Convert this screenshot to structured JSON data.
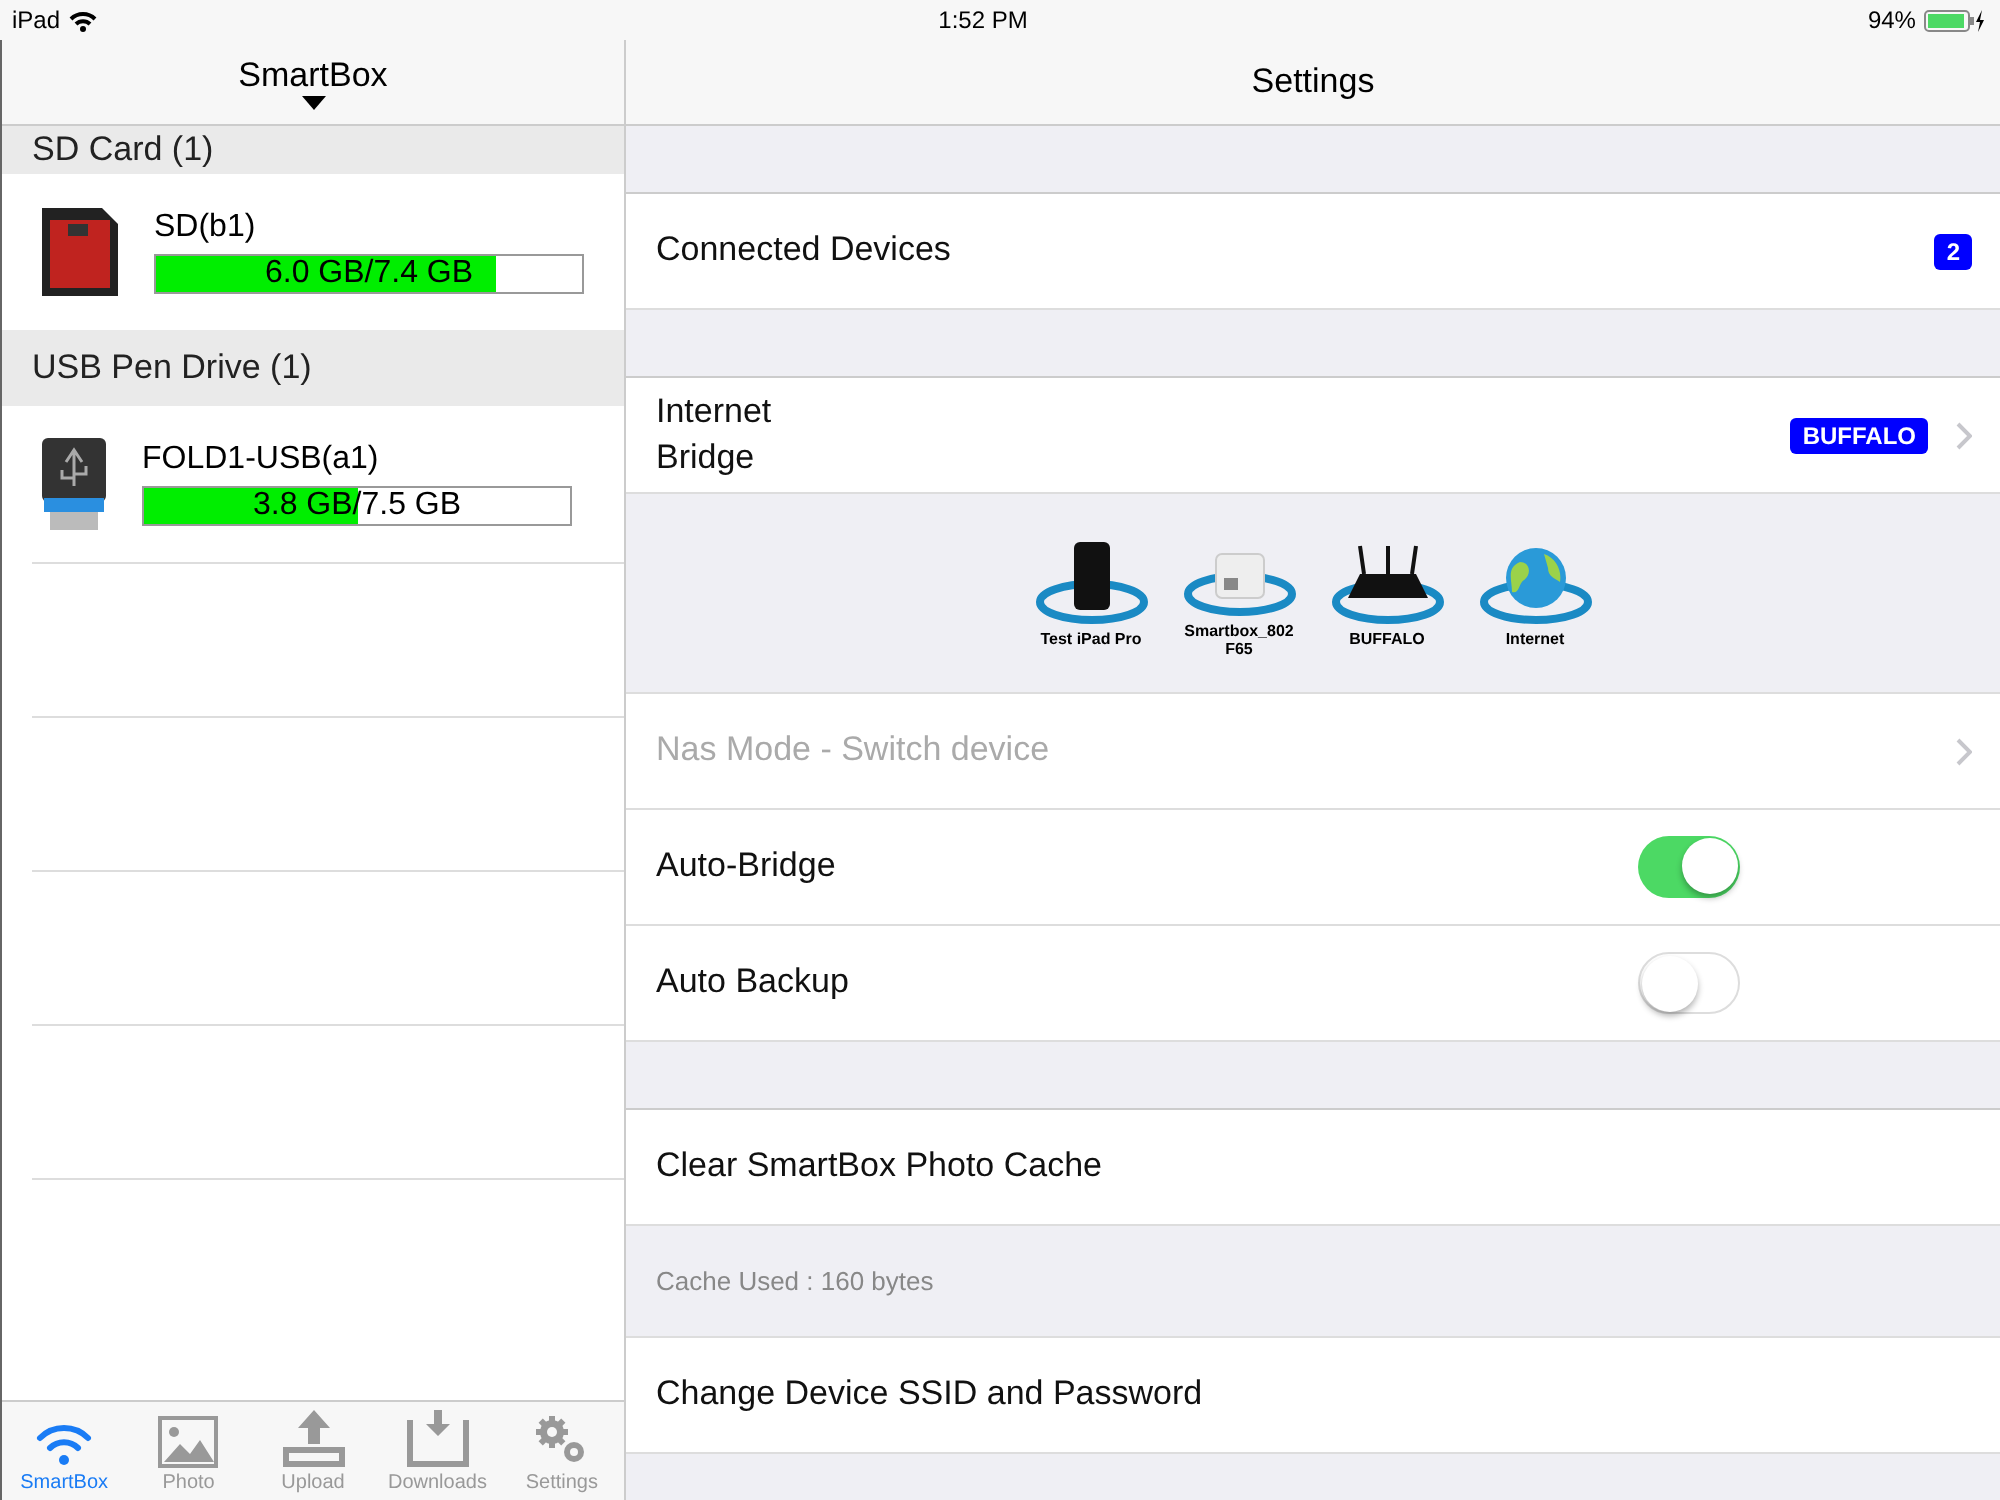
{
  "status_bar": {
    "carrier": "iPad",
    "time": "1:52 PM",
    "battery": "94%"
  },
  "sidebar": {
    "title": "SmartBox",
    "sections": [
      {
        "title": "SD Card (1)",
        "devices": [
          {
            "kind": "sd",
            "name": "SD(b1)",
            "usage": "6.0 GB/7.4 GB",
            "level": 0.8
          }
        ]
      },
      {
        "title": "USB Pen Drive (1)",
        "devices": [
          {
            "kind": "usb",
            "name": "FOLD1-USB(a1)",
            "usage": "3.8 GB/7.5 GB",
            "level": 0.5
          }
        ]
      }
    ]
  },
  "tab_bar": [
    {
      "label": "SmartBox",
      "selected": true
    },
    {
      "label": "Photo",
      "selected": false
    },
    {
      "label": "Upload",
      "selected": false
    },
    {
      "label": "Downloads",
      "selected": false
    },
    {
      "label": "Settings",
      "selected": false
    }
  ],
  "settings": {
    "title": "Settings",
    "groups": [
      [
        {
          "kind": "count",
          "label": "Connected Devices",
          "badge": "2"
        }
      ],
      [
        {
          "kind": "badge",
          "label": "Internet\nBridge",
          "badge": "BUFFALO"
        },
        {
          "kind": "diagram",
          "nodes": [
            {
              "label": "Test iPad Pro"
            },
            {
              "label": "Smartbox_802\nF65"
            },
            {
              "label": "BUFFALO"
            },
            {
              "label": "Internet"
            }
          ]
        },
        {
          "kind": "nav",
          "label": "Nas Mode - Switch device",
          "disabled": true
        },
        {
          "kind": "toggle",
          "label": "Auto-Bridge",
          "on": true
        },
        {
          "kind": "toggle",
          "label": "Auto Backup",
          "on": false
        }
      ],
      [
        {
          "kind": "action",
          "label": "Clear SmartBox Photo Cache"
        },
        {
          "kind": "note",
          "label": "Cache Used : 160 bytes"
        },
        {
          "kind": "action",
          "label": "Change Device SSID and Password"
        }
      ]
    ]
  }
}
